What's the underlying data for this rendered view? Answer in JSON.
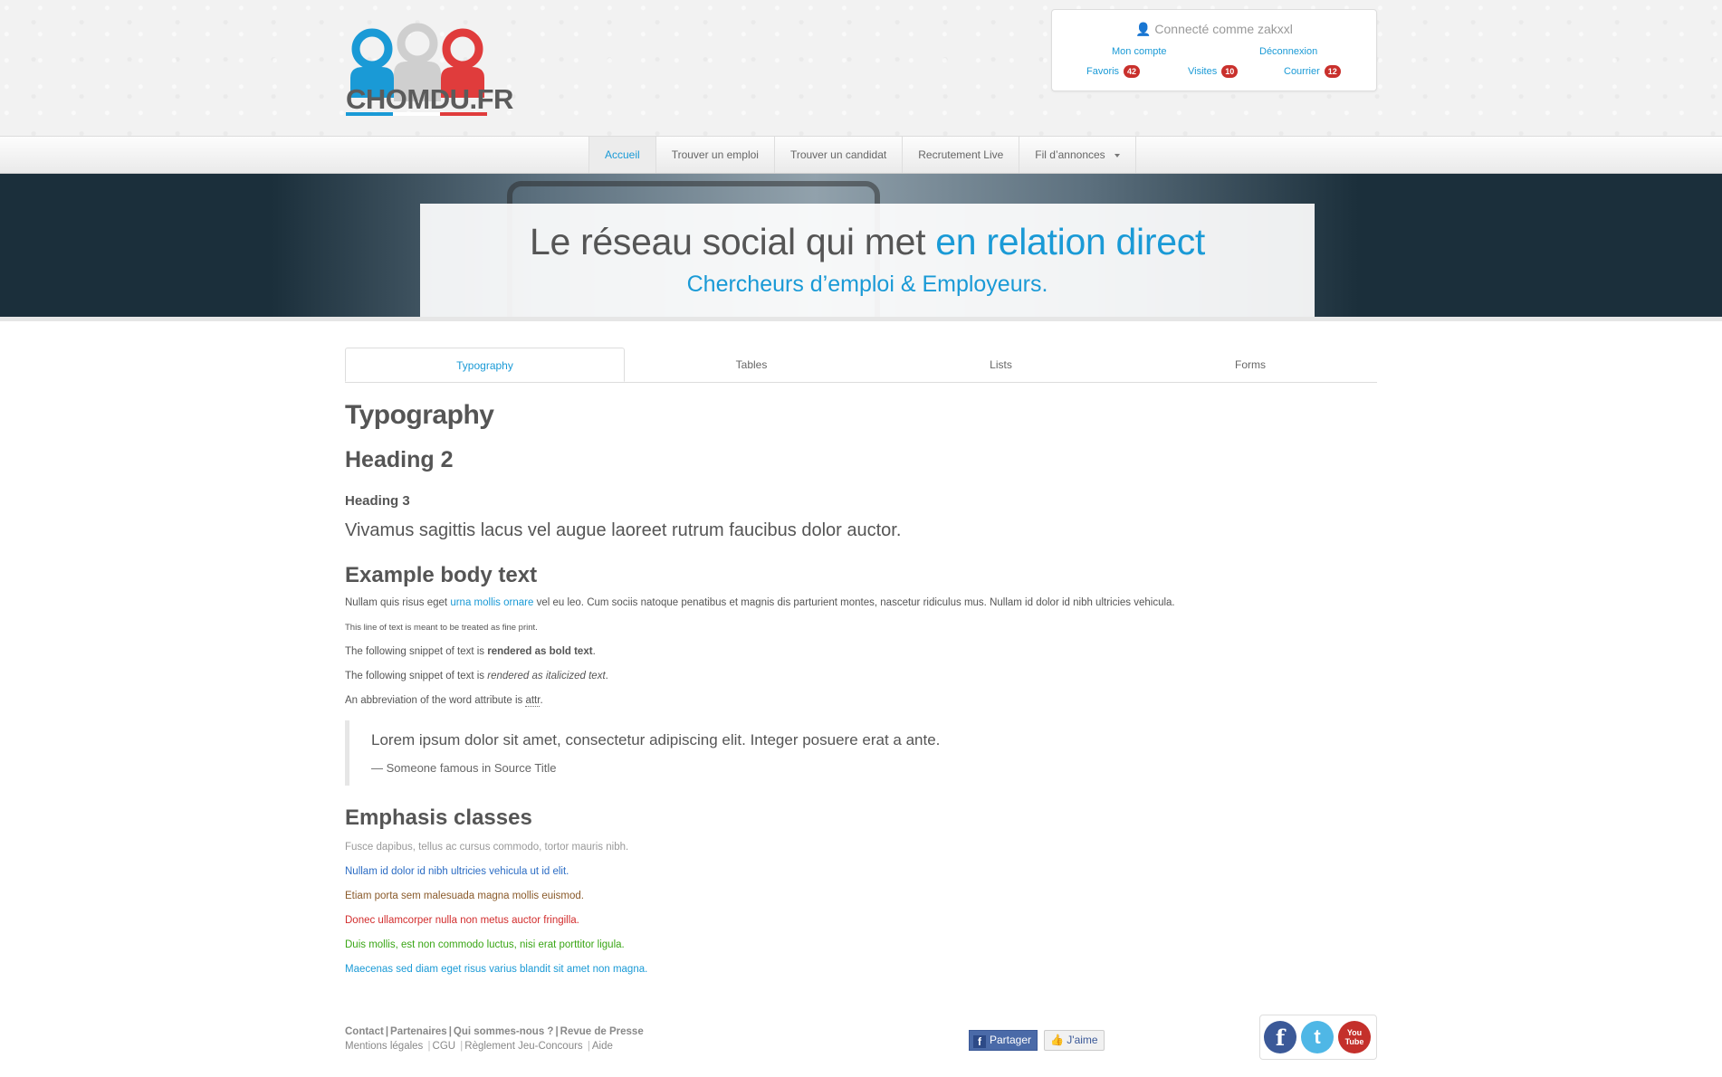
{
  "brand": {
    "name": "CHOMDU.FR",
    "colors": {
      "blue": "#1a9ad6",
      "red": "#e03c3c",
      "grey": "#cfcfcf"
    }
  },
  "userbox": {
    "connected": "Connecté comme zakxxl",
    "account": "Mon compte",
    "logout": "Déconnexion",
    "favorites": {
      "label": "Favoris",
      "count": "42"
    },
    "visits": {
      "label": "Visites",
      "count": "10"
    },
    "mail": {
      "label": "Courrier",
      "count": "12"
    }
  },
  "nav": {
    "items": [
      "Accueil",
      "Trouver un emploi",
      "Trouver un candidat",
      "Recrutement Live",
      "Fil d’annonces"
    ],
    "active": "Accueil"
  },
  "hero": {
    "title_main": "Le réseau social qui met ",
    "title_highlight": "en relation direct",
    "subtitle": "Chercheurs d’emploi & Employeurs."
  },
  "tabs": [
    "Typography",
    "Tables",
    "Lists",
    "Forms"
  ],
  "content": {
    "h1": "Typography",
    "h2": "Heading 2",
    "h3": "Heading 3",
    "lead": "Vivamus sagittis lacus vel augue laoreet rutrum faucibus dolor auctor.",
    "body_heading": "Example body text",
    "body1_pre": "Nullam quis risus eget ",
    "body1_link": "urna mollis ornare",
    "body1_post": " vel eu leo. Cum sociis natoque penatibus et magnis dis parturient montes, nascetur ridiculus mus. Nullam id dolor id nibh ultricies vehicula.",
    "fine_print": "This line of text is meant to be treated as fine print.",
    "bold_pre": "The following snippet of text is ",
    "bold_text": "rendered as bold text",
    "italic_pre": "The following snippet of text is ",
    "italic_text": "rendered as italicized text",
    "abbr_pre": "An abbreviation of the word attribute is ",
    "abbr_text": "attr",
    "quote_text": "Lorem ipsum dolor sit amet, consectetur adipiscing elit. Integer posuere erat a ante.",
    "quote_source": "— Someone famous in Source Title",
    "emphasis_heading": "Emphasis classes",
    "muted": "Fusce dapibus, tellus ac cursus commodo, tortor mauris nibh.",
    "primary": "Nullam id dolor id nibh ultricies vehicula ut id elit.",
    "warning": "Etiam porta sem malesuada magna mollis euismod.",
    "danger": "Donec ullamcorper nulla non metus auctor fringilla.",
    "success": "Duis mollis, est non commodo luctus, nisi erat porttitor ligula.",
    "info": "Maecenas sed diam eget risus varius blandit sit amet non magna."
  },
  "emphasis_colors": {
    "muted": "#999999",
    "primary": "#2b6cc4",
    "warning": "#8a5a2a",
    "danger": "#d22d2d",
    "success": "#3aa616",
    "info": "#1a9ad6"
  },
  "footer": {
    "row1": [
      "Contact",
      "Partenaires",
      "Qui sommes-nous ?",
      "Revue de Presse"
    ],
    "row2": [
      "Mentions légales",
      "CGU",
      "Règlement Jeu-Concours",
      "Aide"
    ],
    "share": "Partager",
    "like": "J'aime",
    "social": [
      {
        "name": "facebook-icon",
        "glyph": "f",
        "color": "#3b5998"
      },
      {
        "name": "twitter-icon",
        "glyph": "t",
        "color": "#4fb7e6"
      },
      {
        "name": "youtube-icon",
        "glyph": "You Tube",
        "color": "#c4302b"
      }
    ]
  }
}
